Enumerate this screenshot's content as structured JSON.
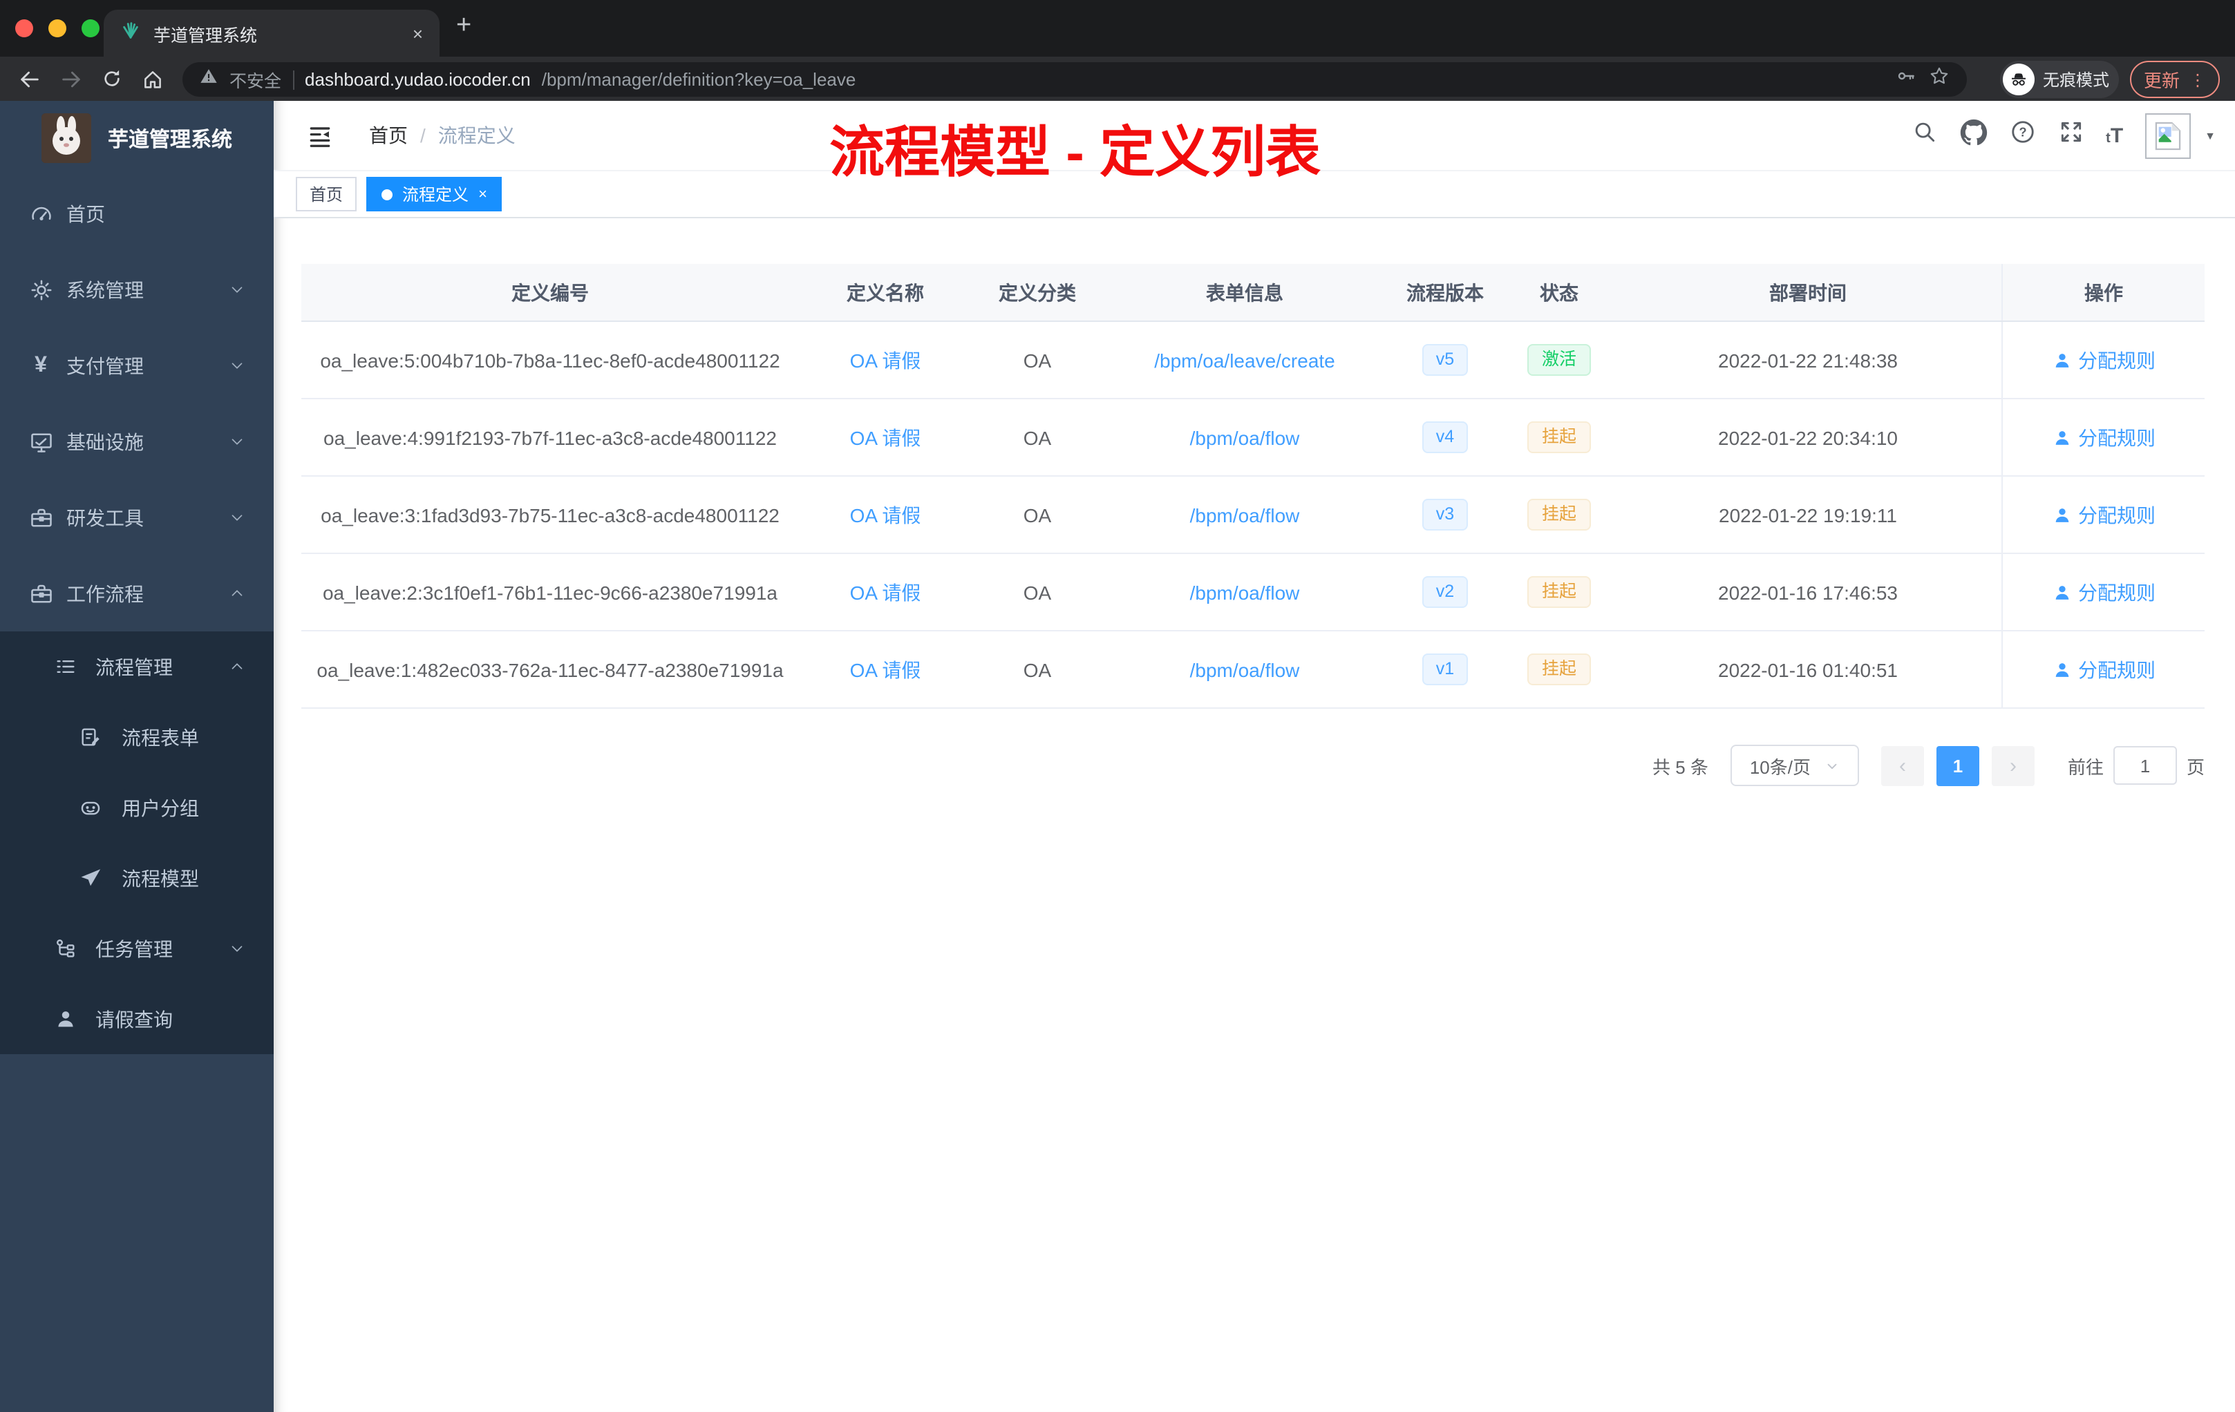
{
  "colors": {
    "accent_blue": "#409eff",
    "tag_active_blue": "#1890ff",
    "success_green": "#13ce66",
    "warning_orange": "#e6a23c",
    "annotation_red": "#f20d0d",
    "sidebar_bg": "#304156",
    "sidebar_submenu_bg": "#1f2d3d"
  },
  "browser": {
    "tab_title": "芋道管理系统",
    "close_glyph": "×",
    "new_tab_glyph": "+",
    "security_label": "不安全",
    "url_host": "dashboard.yudao.iocoder.cn",
    "url_path": "/bpm/manager/definition?key=oa_leave",
    "incognito_label": "无痕模式",
    "update_label": "更新",
    "menu_dots_glyph": "⋮"
  },
  "sidebar": {
    "title": "芋道管理系统",
    "yen_glyph": "¥",
    "items": [
      {
        "label": "首页"
      },
      {
        "label": "系统管理"
      },
      {
        "label": "支付管理"
      },
      {
        "label": "基础设施"
      },
      {
        "label": "研发工具"
      },
      {
        "label": "工作流程"
      },
      {
        "label": "流程管理"
      },
      {
        "label": "流程表单"
      },
      {
        "label": "用户分组"
      },
      {
        "label": "流程模型"
      },
      {
        "label": "任务管理"
      },
      {
        "label": "请假查询"
      }
    ]
  },
  "header": {
    "breadcrumb_home": "首页",
    "breadcrumb_sep": "/",
    "breadcrumb_current": "流程定义",
    "annotation": "流程模型 - 定义列表",
    "font_size_icon_text": "tT",
    "caret_glyph": "▼"
  },
  "tags": {
    "home": "首页",
    "active": "流程定义",
    "close_glyph": "×"
  },
  "table": {
    "columns": [
      "定义编号",
      "定义名称",
      "定义分类",
      "表单信息",
      "流程版本",
      "状态",
      "部署时间",
      "操作"
    ],
    "rows": [
      {
        "id": "oa_leave:5:004b710b-7b8a-11ec-8ef0-acde48001122",
        "name": "OA 请假",
        "category": "OA",
        "form": "/bpm/oa/leave/create",
        "version": "v5",
        "status": "激活",
        "status_type": "success",
        "time": "2022-01-22 21:48:38",
        "action": "分配规则"
      },
      {
        "id": "oa_leave:4:991f2193-7b7f-11ec-a3c8-acde48001122",
        "name": "OA 请假",
        "category": "OA",
        "form": "/bpm/oa/flow",
        "version": "v4",
        "status": "挂起",
        "status_type": "warning",
        "time": "2022-01-22 20:34:10",
        "action": "分配规则"
      },
      {
        "id": "oa_leave:3:1fad3d93-7b75-11ec-a3c8-acde48001122",
        "name": "OA 请假",
        "category": "OA",
        "form": "/bpm/oa/flow",
        "version": "v3",
        "status": "挂起",
        "status_type": "warning",
        "time": "2022-01-22 19:19:11",
        "action": "分配规则"
      },
      {
        "id": "oa_leave:2:3c1f0ef1-76b1-11ec-9c66-a2380e71991a",
        "name": "OA 请假",
        "category": "OA",
        "form": "/bpm/oa/flow",
        "version": "v2",
        "status": "挂起",
        "status_type": "warning",
        "time": "2022-01-16 17:46:53",
        "action": "分配规则"
      },
      {
        "id": "oa_leave:1:482ec033-762a-11ec-8477-a2380e71991a",
        "name": "OA 请假",
        "category": "OA",
        "form": "/bpm/oa/flow",
        "version": "v1",
        "status": "挂起",
        "status_type": "warning",
        "time": "2022-01-16 01:40:51",
        "action": "分配规则"
      }
    ]
  },
  "pagination": {
    "total": "共 5 条",
    "page_size": "10条/页",
    "prev_glyph": "‹",
    "current_page": "1",
    "next_glyph": "›",
    "goto_label": "前往",
    "goto_value": "1",
    "unit_label": "页"
  }
}
